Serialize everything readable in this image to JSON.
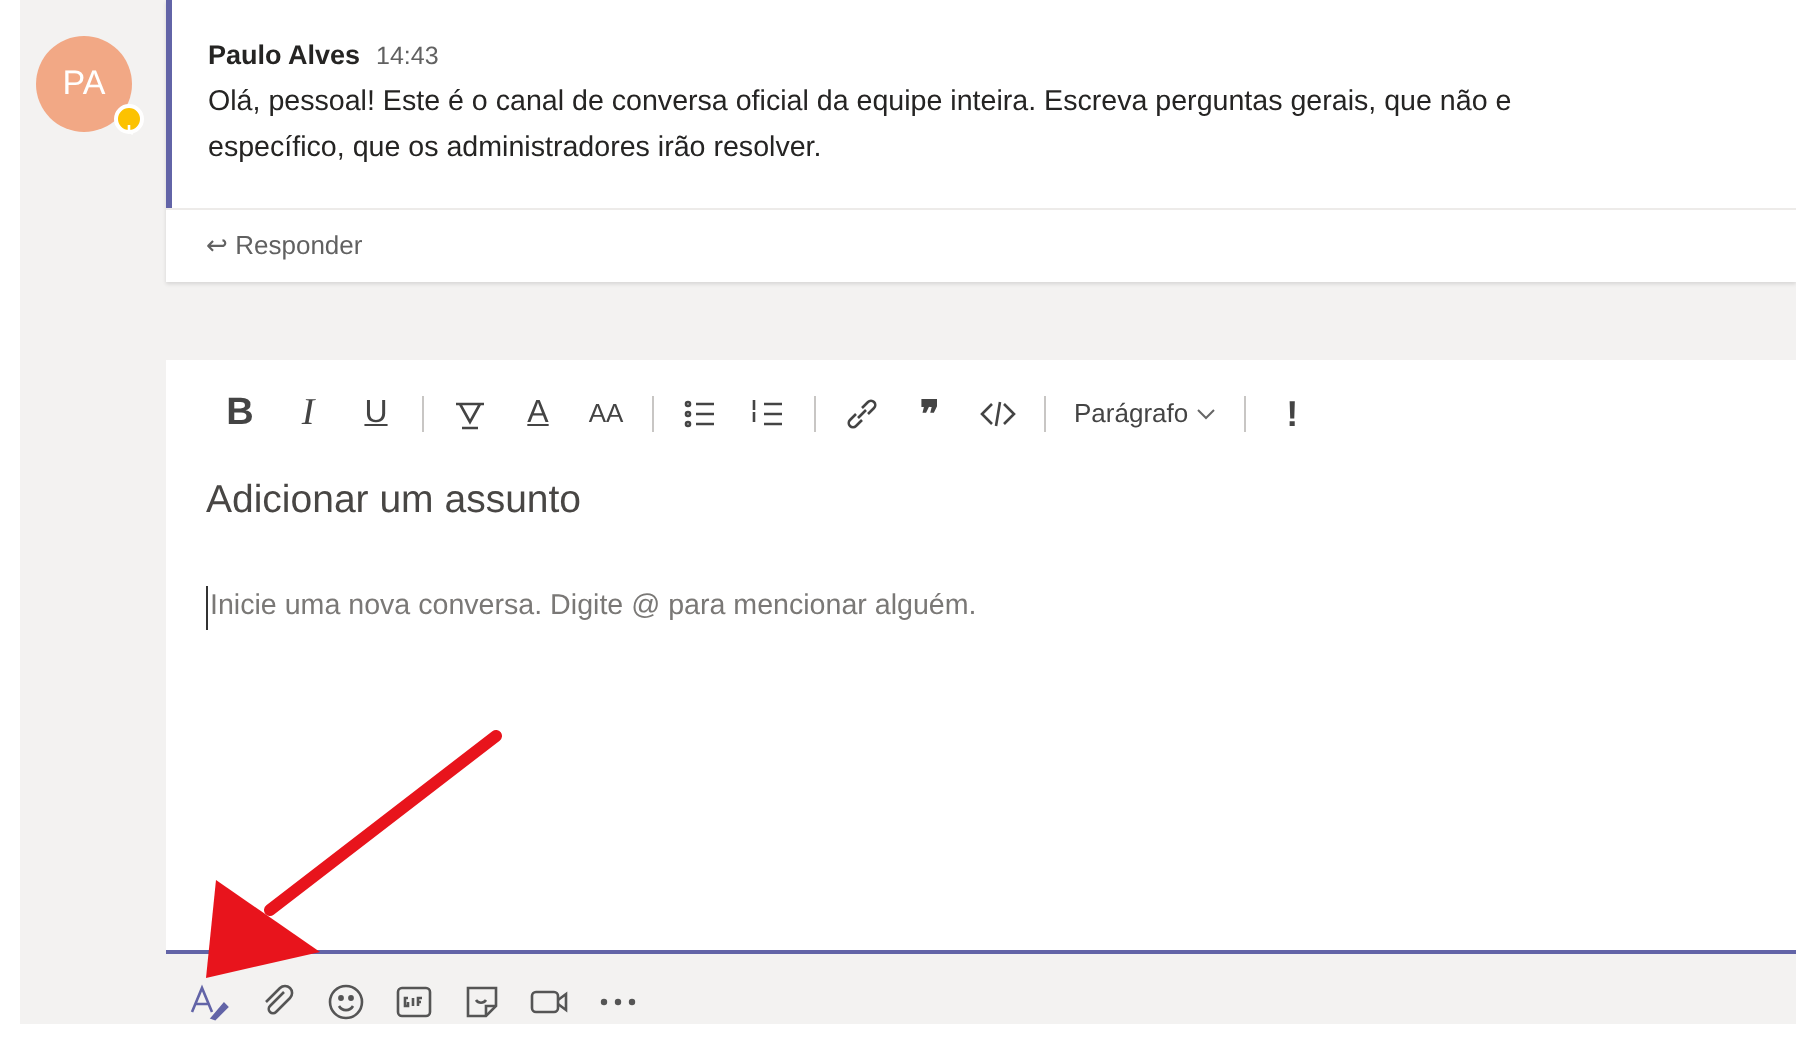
{
  "message": {
    "avatar_initials": "PA",
    "away": true,
    "author": "Paulo Alves",
    "time": "14:43",
    "lines": [
      "Olá, pessoal! Este é o canal de conversa oficial da equipe inteira. Escreva perguntas gerais, que não e",
      "específico, que os administradores irão resolver."
    ],
    "reply_icon": "↩",
    "reply_label": "Responder"
  },
  "composer": {
    "format_toolbar": [
      {
        "kind": "glyph",
        "text": "B"
      },
      {
        "kind": "glyph",
        "text": "I"
      },
      {
        "kind": "glyph",
        "text": "U"
      },
      {
        "kind": "separator"
      },
      {
        "kind": "icon"
      },
      {
        "kind": "glyph",
        "text": "A"
      },
      {
        "kind": "glyph",
        "text": "AA"
      },
      {
        "kind": "separator"
      },
      {
        "kind": "icon"
      },
      {
        "kind": "icon"
      },
      {
        "kind": "separator"
      },
      {
        "kind": "icon"
      },
      {
        "kind": "glyph",
        "text": "❞"
      },
      {
        "kind": "icon"
      },
      {
        "kind": "separator"
      },
      {
        "kind": "dropdown",
        "text": "Parágrafo"
      },
      {
        "kind": "separator"
      },
      {
        "kind": "glyph",
        "text": "!"
      }
    ],
    "subject_placeholder": "Adicionar um assunto",
    "body_placeholder": "Inicie uma nova conversa. Digite @ para mencionar alguém.",
    "actions": [
      {
        "kind": "format"
      },
      {
        "kind": "attach"
      },
      {
        "kind": "emoji"
      },
      {
        "kind": "gif"
      },
      {
        "kind": "sticker"
      },
      {
        "kind": "meet"
      },
      {
        "kind": "more"
      }
    ]
  },
  "annotation": {
    "kind": "arrow"
  }
}
